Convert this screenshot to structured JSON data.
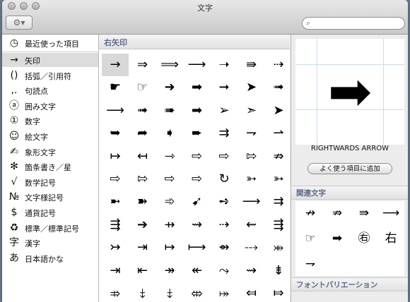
{
  "window": {
    "title": "文字"
  },
  "toolbar": {
    "action_icon": "⚙▾",
    "search_icon": "⌕",
    "search_placeholder": "",
    "search_value": ""
  },
  "sidebar": {
    "items": [
      {
        "icon": "◷",
        "label": "最近使った項目"
      },
      {
        "icon": "→",
        "label": "矢印"
      },
      {
        "icon": "()",
        "label": "括弧／引用符"
      },
      {
        "icon": ",.",
        "label": "句読点"
      },
      {
        "icon": "ⓐ",
        "label": "囲み文字"
      },
      {
        "icon": "①",
        "label": "数字"
      },
      {
        "icon": "☺",
        "label": "絵文字"
      },
      {
        "icon": "✍",
        "label": "象形文字"
      },
      {
        "icon": "✻",
        "label": "箇条書き／星"
      },
      {
        "icon": "√",
        "label": "数学記号"
      },
      {
        "icon": "№",
        "label": "文字様記号"
      },
      {
        "icon": "$",
        "label": "通貨記号"
      },
      {
        "icon": "♻",
        "label": "標準／標準記号"
      },
      {
        "icon": "字",
        "label": "漢字"
      },
      {
        "icon": "あ",
        "label": "日本語かな"
      }
    ],
    "selected_index": 1
  },
  "grid": {
    "header": "右矢印",
    "rows": [
      [
        "→",
        "⇒",
        "⟹",
        "⟶",
        "➝",
        "⇛",
        "⇢"
      ],
      [
        "☛",
        "☞",
        "➜",
        "➡",
        "➞",
        "➤",
        "➟"
      ],
      [
        "⟶",
        "➟",
        "➠",
        "➡",
        "➢",
        "➣",
        "➤"
      ],
      [
        "➥",
        "➦",
        "➧",
        "➨",
        "⇉",
        "⇁",
        "⇀"
      ],
      [
        "↦",
        "↤",
        "⇾",
        "⇨",
        "⇨",
        "⇰",
        "⇏"
      ],
      [
        "⇨",
        "⇰",
        "⇨",
        "⇨",
        "↻",
        "➳",
        "➳"
      ],
      [
        "➼",
        "➽",
        "➾",
        "➹",
        "➺",
        "⟶",
        "⇉"
      ],
      [
        "⇶",
        "➔",
        "⇸",
        "⇝",
        "⇢",
        "⇜",
        "⇶"
      ],
      [
        "↣",
        "⇥",
        "↦",
        "⟼",
        "⇴",
        "⤏",
        "⤕"
      ],
      [
        "⇥",
        "⇤",
        "↠",
        "↞",
        "⤳",
        "⇝",
        "⇟"
      ],
      [
        "⤃",
        "⤈",
        "⤈",
        "⤄",
        "⤅",
        "⤆",
        "⤇"
      ]
    ]
  },
  "detail": {
    "preview_char": "➡",
    "char_name": "RIGHTWARDS ARROW",
    "fav_button": "よく使う項目に追加",
    "related_header": "関連文字",
    "related": [
      "↛",
      "⇏",
      "⇛",
      "⟶",
      "☞",
      "➡",
      "㊨",
      "右",
      "⇁"
    ],
    "font_variation_header": "フォントバリエーション"
  }
}
